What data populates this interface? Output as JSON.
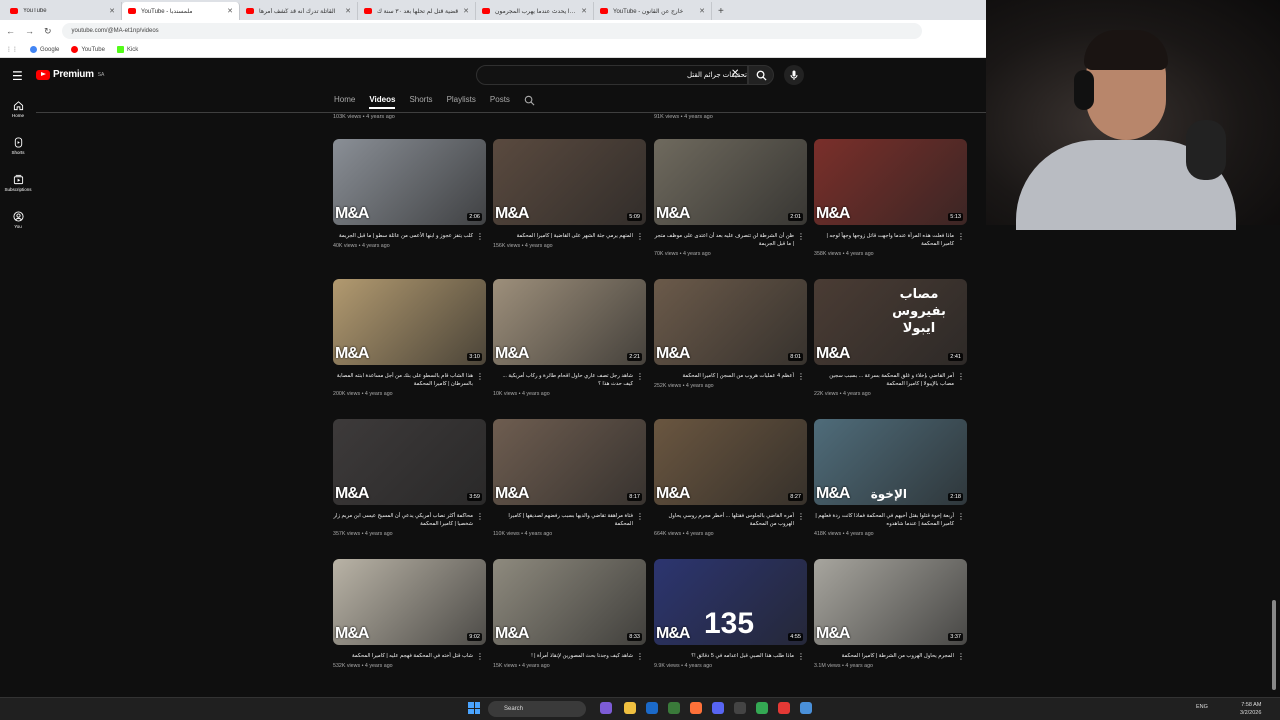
{
  "browser": {
    "tabs": [
      {
        "title": "YouTube",
        "active": false
      },
      {
        "title": "YouTube - ملمسندبا",
        "active": true
      },
      {
        "title": "القاتلة تدرك أنه قد كُشف أمرها",
        "active": false
      },
      {
        "title": "قضية قتل لم تحلها بعد ٣٠ سنة ك",
        "active": false
      },
      {
        "title": "ماذا يحدث عندما يهرب المجرمون",
        "active": false
      },
      {
        "title": "YouTube - خارج عن القانون",
        "active": false
      }
    ],
    "url": "youtube.com/@MA-et1np/videos",
    "bookmarks": [
      {
        "label": "Google",
        "color": "#4285f4"
      },
      {
        "label": "YouTube",
        "color": "#ff0000"
      },
      {
        "label": "Kick",
        "color": "#53fc18"
      }
    ]
  },
  "header": {
    "logo_text": "Premium",
    "region": "SA",
    "search_value": "تحقيقات جرائم القتل"
  },
  "rail": [
    {
      "label": "Home",
      "icon": "home-icon"
    },
    {
      "label": "Shorts",
      "icon": "shorts-icon"
    },
    {
      "label": "Subscriptions",
      "icon": "subscriptions-icon"
    },
    {
      "label": "You",
      "icon": "you-icon"
    }
  ],
  "channel_tabs": [
    "Home",
    "Videos",
    "Shorts",
    "Playlists",
    "Posts"
  ],
  "top_meta": [
    {
      "views": "103K views",
      "age": "4 years ago"
    },
    {
      "views": "91K views",
      "age": "4 years ago"
    }
  ],
  "videos": [
    {
      "title": "كلب يتفز عجوز و ابنها الأعمى من عائلة سطو | ما قبل الجريمة",
      "views": "40K views",
      "age": "4 years ago",
      "duration": "2:06",
      "color": "#8a8f96"
    },
    {
      "title": "المتهم يرمي جثة الشهر على القاضية | كاميرا المحكمة",
      "views": "156K views",
      "age": "4 years ago",
      "duration": "5:09",
      "color": "#5a4a3f"
    },
    {
      "title": "ظن أن الشرطة لن تتصرف عليه بعد أن اعتدى على موظف متجر | ما قبل الجريمة",
      "views": "70K views",
      "age": "4 years ago",
      "duration": "2:01",
      "color": "#6f6a5e"
    },
    {
      "title": "ماذا فعلت هذه المرأة عندما واجهت قاتل زوجها وجهاً لوجه | كاميرا المحكمة",
      "views": "358K views",
      "age": "4 years ago",
      "duration": "5:13",
      "color": "#7a2f2a"
    },
    {
      "title": "هذا الشاب قام بالسطو على بنك من أجل مساعدة ابنته المصابة بالسرطان | كاميرا المحكمة",
      "views": "200K views",
      "age": "4 years ago",
      "duration": "3:10",
      "color": "#b29a70"
    },
    {
      "title": "شاهد رجل تصف عاري حاول اقحام طائرة و ركاب أمريكية ... كيف حدث هذا ؟",
      "views": "10K views",
      "age": "4 years ago",
      "duration": "2:21",
      "color": "#9d8f7b"
    },
    {
      "title": "أعظم 4 عمليات هروب من السجن | كاميرا المحكمة",
      "views": "252K views",
      "age": "4 years ago",
      "duration": "8:01",
      "color": "#6b5a4a"
    },
    {
      "title": "أمر القاضي بإخلاء و غلق المحكمة بسرعة ... بسبب سجين مصاب بالإيبولا | كاميرا المحكمة",
      "views": "22K views",
      "age": "4 years ago",
      "duration": "2:41",
      "color": "#4a3c34"
    },
    {
      "title": "محاكمة أكثر نصاب أمريكي يدعي أن المسيح عيسى ابن مريم زار شخصيا | كاميرا المحكمة",
      "views": "357K views",
      "age": "4 years ago",
      "duration": "3:59",
      "color": "#3d3a3a"
    },
    {
      "title": "فتاة مراهقة تقاضي والديها بسبب رفضهم لصديقها | كاميرا المحكمة",
      "views": "110K views",
      "age": "4 years ago",
      "duration": "8:17",
      "color": "#6e5d50"
    },
    {
      "title": "أمره القاضي بالجلوس فقتلها ... أخطر مجرم روسي يحاول الهروب من المحكمة",
      "views": "664K views",
      "age": "4 years ago",
      "duration": "8:27",
      "color": "#6a5640"
    },
    {
      "title": "أربعة إخوة قتلوا بقتل أخيهم في المحكمة فماذا كانت ردة فعلهم | كاميرا المحكمة | عندما شاهدوه",
      "views": "418K views",
      "age": "4 years ago",
      "duration": "2:18",
      "color": "#4f6c7a"
    },
    {
      "title": "شاب قتل أخته في المحكمة فهجم عليه | كاميرا المحكمة",
      "views": "532K views",
      "age": "4 years ago",
      "duration": "9:02",
      "color": "#b9b3a6"
    },
    {
      "title": "شاهد كيف وجدنا بحث المصورين لإنقاذ أمرأة | !",
      "views": "15K views",
      "age": "4 years ago",
      "duration": "8:33",
      "color": "#8e8a7e"
    },
    {
      "title": "ماذا طلب هذا الصبي قبل اعدامه في 5 دقائق !؟",
      "views": "9.9K views",
      "age": "4 years ago",
      "duration": "4:55",
      "color": "#2c3570",
      "text": "135"
    },
    {
      "title": "المجرم يحاول الهروب من الشرطة | كاميرا المحكمة",
      "views": "3.1M views",
      "age": "4 years ago",
      "duration": "3:37",
      "color": "#a7a59e"
    }
  ],
  "watermark": "M&A",
  "thumb_overlay_texts": {
    "v8": "مصاب بفيروس ايبولا",
    "v12": "الإخوة"
  },
  "taskbar": {
    "search_label": "Search",
    "lang": "ENG",
    "time": "7:58 AM",
    "date": "3/2/2026"
  }
}
